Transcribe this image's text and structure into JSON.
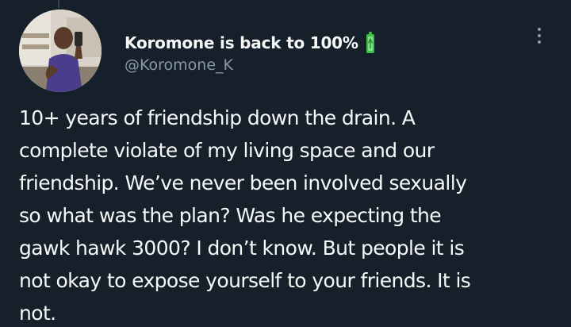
{
  "tweet": {
    "author": {
      "display_name": "Koromone is back to 100%",
      "status_icon": "battery-full-icon",
      "handle": "@Koromone_K",
      "avatar": "profile-photo"
    },
    "menu_icon": "more-vertical-icon",
    "text_lines": [
      "10+ years of friendship down the drain. A",
      "complete violate of my living space and our",
      "friendship. We’ve never been involved sexually",
      "so what was the plan? Was he expecting the",
      "gawk hawk 3000? I don’t know. But people it is",
      "not okay to expose yourself to your friends. It is",
      "not."
    ]
  },
  "colors": {
    "background": "#15202b",
    "text_primary": "#f7f9f9",
    "text_secondary": "#8b98a5",
    "battery_green": "#3fbf4a"
  }
}
